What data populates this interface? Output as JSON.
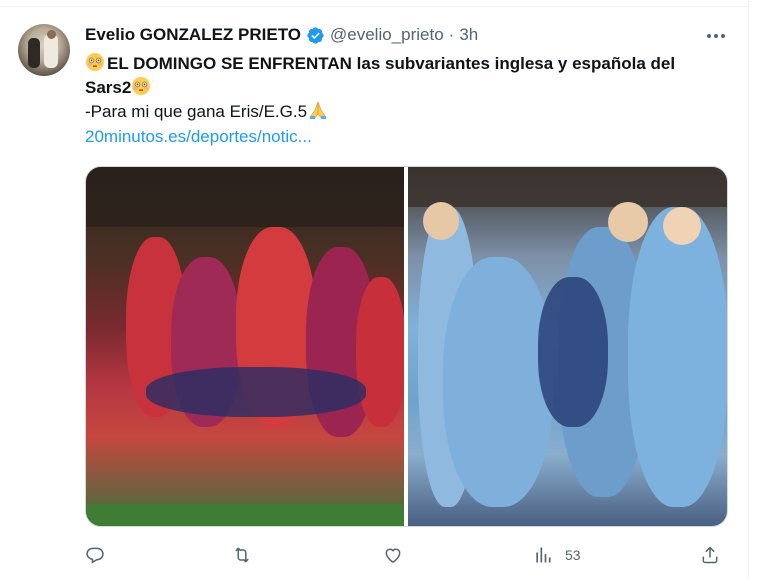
{
  "tweet": {
    "display_name": "Evelio GONZALEZ PRIETO",
    "handle": "@evelio_prieto",
    "separator": "·",
    "time": "3h",
    "line1": "EL DOMINGO SE ENFRENTAN las subvariantes inglesa y española del",
    "line2": "Sars2",
    "line3": "-Para mi que gana Eris/E.G.5",
    "link": "20minutos.es/deportes/notic..."
  },
  "icons": {
    "verified": "verified-badge-icon",
    "more": "more-options-icon",
    "flushed_emoji": "flushed-face-emoji",
    "pray_emoji": "folded-hands-emoji",
    "reply": "reply-icon",
    "retweet": "retweet-icon",
    "like": "like-icon",
    "views": "views-icon",
    "share": "share-icon"
  },
  "media": {
    "left_photo": "spain-team-celebration",
    "right_photo": "england-team-celebration"
  },
  "actions": {
    "views_count": "53"
  },
  "colors": {
    "accent": "#1d9bf0",
    "secondary_text": "#536471",
    "primary_text": "#0f1419"
  }
}
